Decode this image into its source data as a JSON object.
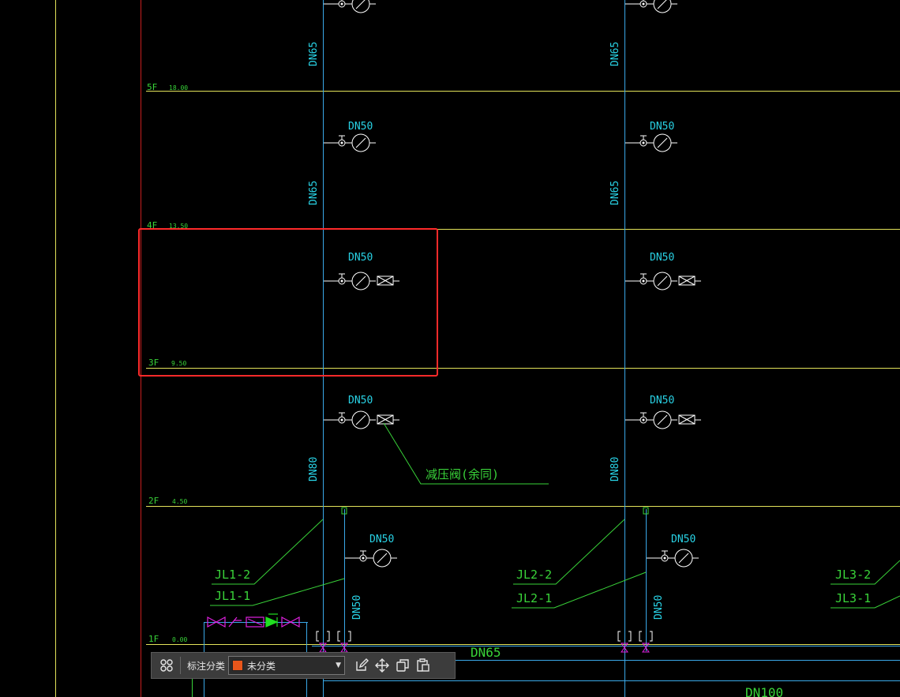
{
  "colors": {
    "pipe": "#3aa8e8",
    "floor_line": "#e3e35a",
    "leader": "#39d339",
    "text_cyan": "#29d3e6",
    "symbol": "#ffffff",
    "selection": "#ff2a2a",
    "border_red": "#c81e1e",
    "valve_magenta": "#e020e0",
    "valve_green": "#20e020",
    "swatch_unclassified": "#e8561b"
  },
  "floors": [
    {
      "name": "5F",
      "elev": "18.00"
    },
    {
      "name": "4F",
      "elev": "13.50"
    },
    {
      "name": "3F",
      "elev": "9.50"
    },
    {
      "name": "2F",
      "elev": "4.50"
    },
    {
      "name": "1F",
      "elev": "0.00"
    }
  ],
  "branch_label": "DN50",
  "riser_labels": {
    "upper": "DN65",
    "lower": "DN80",
    "ground": "DN50"
  },
  "annotation": {
    "prv": "减压阀(余同)"
  },
  "riser_tags": {
    "jl1_2": "JL1-2",
    "jl1_1": "JL1-1",
    "jl2_2": "JL2-2",
    "jl2_1": "JL2-1",
    "jl3_2": "JL3-2",
    "jl3_1": "JL3-1"
  },
  "main_labels": {
    "main1": "DN65",
    "main2": "DN100"
  },
  "toolbar": {
    "category_label": "标注分类",
    "category_value": "未分类"
  }
}
